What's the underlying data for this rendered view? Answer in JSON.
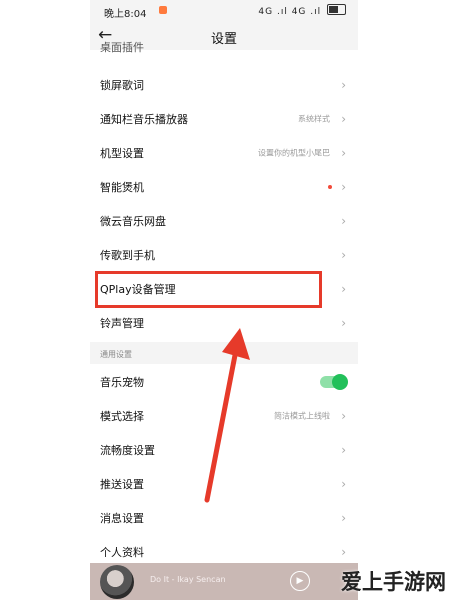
{
  "status_bar": {
    "time": "晚上8:04",
    "signal": "4G .ıl 4G .ıl"
  },
  "header": {
    "back_icon": "back-arrow-icon",
    "title": "设置"
  },
  "top_partial_row": "桌面插件",
  "rows": [
    {
      "label": "锁屏歌词",
      "value": ""
    },
    {
      "label": "通知栏音乐播放器",
      "value": "系统样式"
    },
    {
      "label": "机型设置",
      "value": "设置你的机型小尾巴"
    },
    {
      "label": "智能煲机",
      "value": ""
    },
    {
      "label": "微云音乐网盘",
      "value": ""
    },
    {
      "label": "传歌到手机",
      "value": ""
    },
    {
      "label": "QPlay设备管理",
      "value": ""
    },
    {
      "label": "铃声管理",
      "value": ""
    }
  ],
  "section_general": "通用设置",
  "general_rows": [
    {
      "label": "音乐宠物",
      "value": ""
    },
    {
      "label": "模式选择",
      "value": "简洁模式上线啦"
    },
    {
      "label": "流畅度设置",
      "value": ""
    },
    {
      "label": "推送设置",
      "value": ""
    },
    {
      "label": "消息设置",
      "value": ""
    },
    {
      "label": "个人资料",
      "value": ""
    }
  ],
  "player": {
    "title": "Do It - Ikay Sencan"
  },
  "watermark": "爱上手游网",
  "colors": {
    "highlight": "#e63a2a",
    "toggle_on": "#22c05a",
    "red_dot": "#f24b3a"
  }
}
